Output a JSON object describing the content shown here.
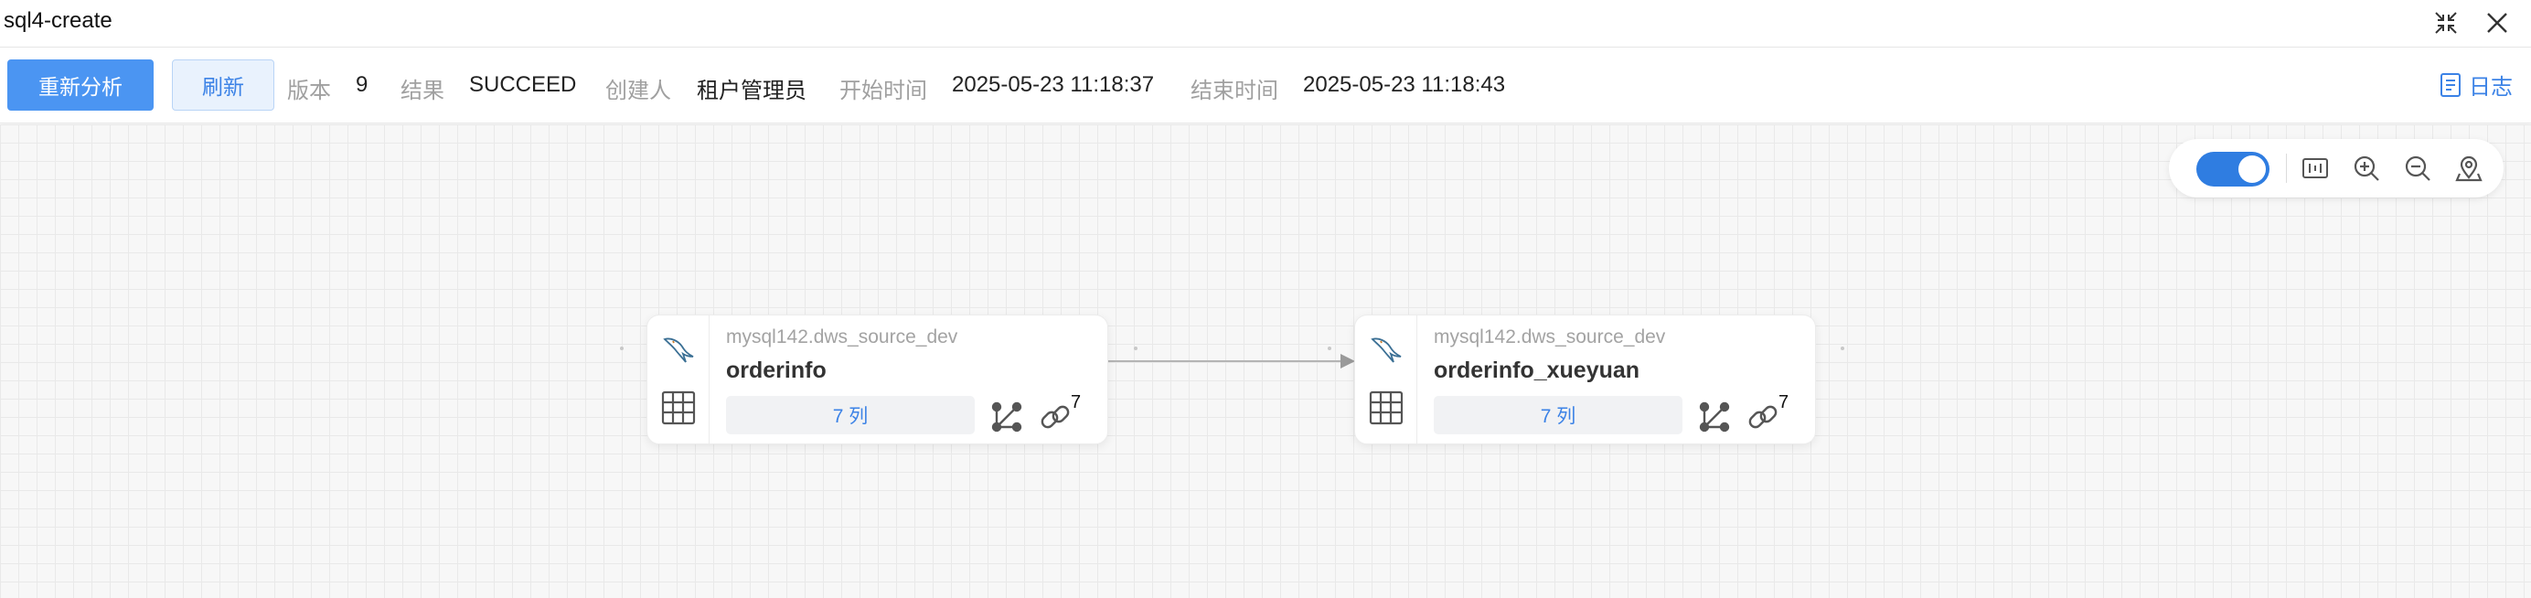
{
  "window": {
    "title": "sql4-create"
  },
  "toolbar": {
    "reanalyze_label": "重新分析",
    "refresh_label": "刷新",
    "version_key": "版本",
    "version_value": "9",
    "result_key": "结果",
    "result_value": "SUCCEED",
    "creator_key": "创建人",
    "creator_value": "租户管理员",
    "start_key": "开始时间",
    "start_value": "2025-05-23 11:18:37",
    "end_key": "结束时间",
    "end_value": "2025-05-23 11:18:43",
    "log_label": "日志"
  },
  "canvas_tools": {
    "toggle_on": true
  },
  "nodes": [
    {
      "source": "mysql142.dws_source_dev",
      "name": "orderinfo",
      "columns_label": "7 列",
      "link_count": "7"
    },
    {
      "source": "mysql142.dws_source_dev",
      "name": "orderinfo_xueyuan",
      "columns_label": "7 列",
      "link_count": "7"
    }
  ],
  "colors": {
    "primary": "#4b95f2",
    "link": "#3b82e6",
    "toggle": "#2f7de1"
  }
}
